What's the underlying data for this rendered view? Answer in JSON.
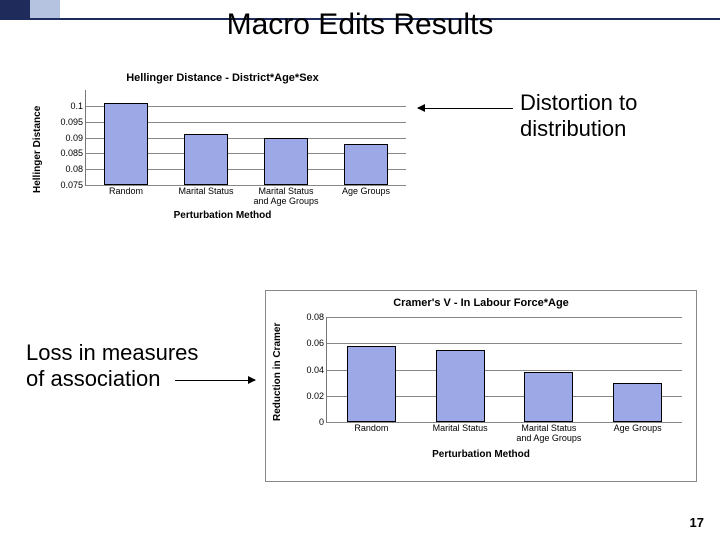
{
  "title": "Macro Edits Results",
  "annot1": "Distortion to\ndistribution",
  "annot2": "Loss in measures\nof association",
  "page": "17",
  "chart_data": [
    {
      "type": "bar",
      "title": "Hellinger Distance - District*Age*Sex",
      "ylabel": "Hellinger Distance",
      "xlabel": "Perturbation Method",
      "categories": [
        "Random",
        "Marital Status",
        "Marital Status\nand Age Groups",
        "Age Groups"
      ],
      "values": [
        0.101,
        0.091,
        0.09,
        0.088
      ],
      "ylim": [
        0.075,
        0.105
      ],
      "ticks": [
        "0.075",
        "0.08",
        "0.085",
        "0.09",
        "0.095",
        "0.1"
      ]
    },
    {
      "type": "bar",
      "title": "Cramer's V - In Labour Force*Age",
      "ylabel": "Reduction in Cramer",
      "xlabel": "Perturbation Method",
      "categories": [
        "Random",
        "Marital Status",
        "Marital Status\nand Age Groups",
        "Age Groups"
      ],
      "values": [
        0.058,
        0.055,
        0.038,
        0.03
      ],
      "ylim": [
        0,
        0.08
      ],
      "ticks": [
        "0",
        "0.02",
        "0.04",
        "0.06",
        "0.08"
      ]
    }
  ]
}
